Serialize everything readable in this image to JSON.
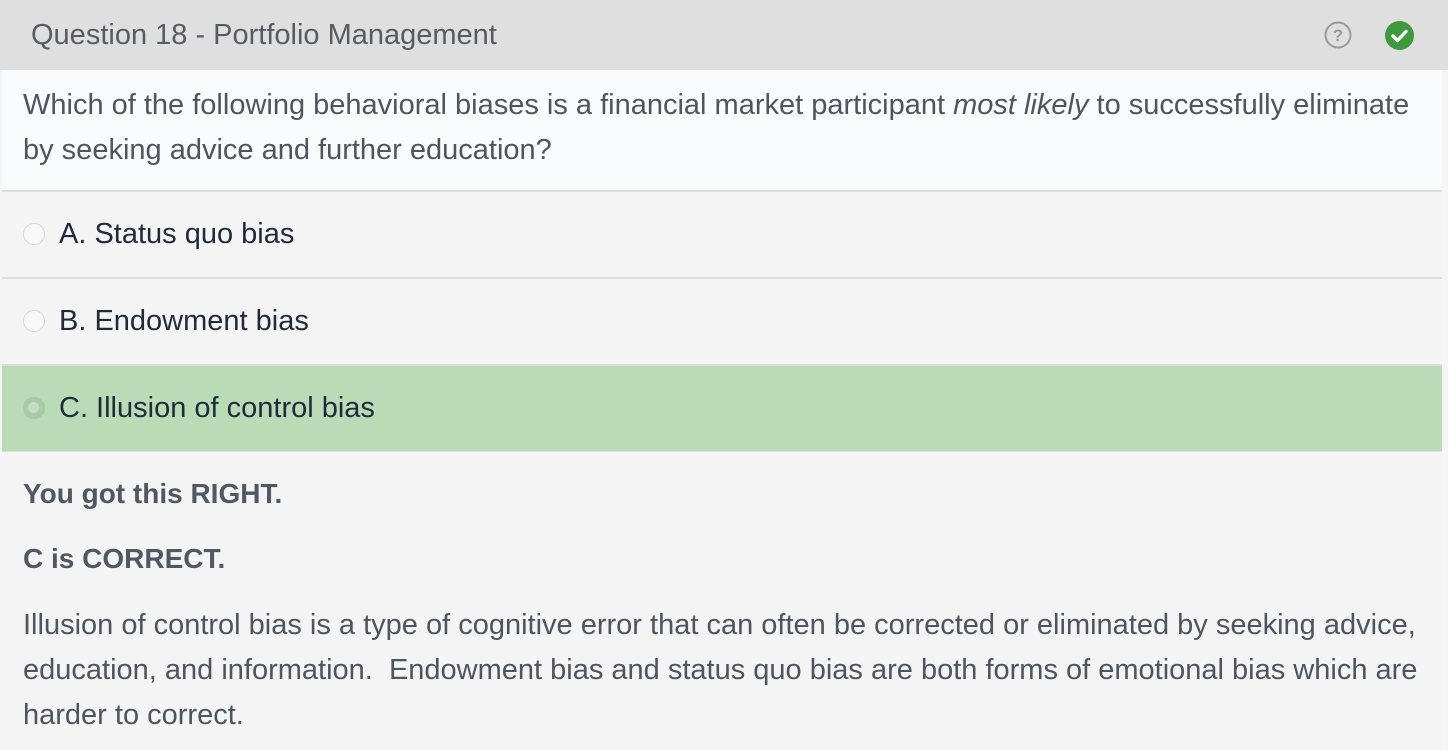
{
  "header": {
    "title": "Question 18 - Portfolio Management",
    "help_icon": "question-circle-icon",
    "status_icon": "check-circle-icon",
    "status_color": "#3c9a3c"
  },
  "question": {
    "text_before": "Which of the following behavioral biases is a financial market participant ",
    "emphasis": "most likely",
    "text_after": " to successfully eliminate by seeking advice and further education?"
  },
  "options": [
    {
      "label": "A. Status quo bias",
      "selected": false,
      "correct": false
    },
    {
      "label": "B. Endowment bias",
      "selected": false,
      "correct": false
    },
    {
      "label": "C. Illusion of control bias",
      "selected": true,
      "correct": true
    }
  ],
  "feedback": {
    "result": "You got this RIGHT.",
    "correct_answer": "C is CORRECT.",
    "explanation": "Illusion of control bias is a type of cognitive error that can often be corrected or eliminated by seeking advice, education, and information.  Endowment bias and status quo bias are both forms of emotional bias which are harder to correct.",
    "highlight_color": "#b9dbb6"
  }
}
